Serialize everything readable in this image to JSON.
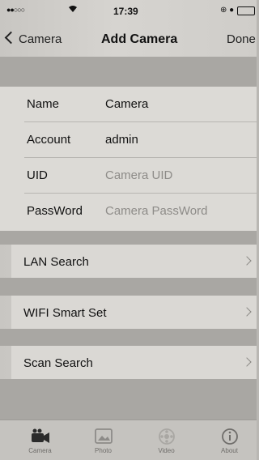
{
  "status": {
    "signal": "●●○○○",
    "time": "17:39",
    "right": "⊕ ●"
  },
  "nav": {
    "back_label": "Camera",
    "title": "Add Camera",
    "done_label": "Done"
  },
  "form": {
    "rows": [
      {
        "label": "Name",
        "value": "Camera",
        "is_placeholder": false
      },
      {
        "label": "Account",
        "value": "admin",
        "is_placeholder": false
      },
      {
        "label": "UID",
        "value": "Camera UID",
        "is_placeholder": true
      },
      {
        "label": "PassWord",
        "value": "Camera PassWord",
        "is_placeholder": true
      }
    ]
  },
  "actions": [
    {
      "label": "LAN Search"
    },
    {
      "label": "WIFI Smart Set"
    },
    {
      "label": "Scan Search"
    }
  ],
  "tabs": [
    {
      "label": "Camera",
      "icon": "camera-icon"
    },
    {
      "label": "Photo",
      "icon": "photo-icon"
    },
    {
      "label": "Video",
      "icon": "video-icon"
    },
    {
      "label": "About",
      "icon": "info-icon"
    }
  ],
  "colors": {
    "tab_active": "#2b2b2b",
    "tab_inactive": "#8d8b88"
  }
}
